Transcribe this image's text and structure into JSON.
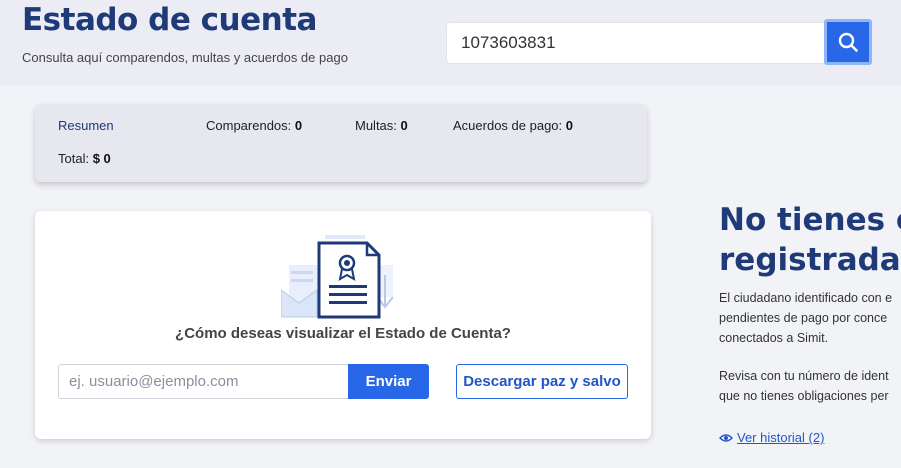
{
  "header": {
    "title": "Estado de cuenta",
    "subtitle": "Consulta aquí comparendos, multas y acuerdos de pago",
    "search_value": "1073603831",
    "search_icon": "search-icon"
  },
  "summary": {
    "resumen_label": "Resumen",
    "comparendos_label": "Comparendos:",
    "comparendos_value": "0",
    "multas_label": "Multas:",
    "multas_value": "0",
    "acuerdos_label": "Acuerdos de pago:",
    "acuerdos_value": "0",
    "total_label": "Total:",
    "total_value": "$ 0"
  },
  "main": {
    "illustration_icon": "document-certificate-icon",
    "question": "¿Cómo deseas visualizar el Estado de Cuenta?",
    "email_placeholder": "ej. usuario@ejemplo.com",
    "send_label": "Enviar",
    "download_label": "Descargar paz y salvo"
  },
  "right": {
    "heading_line1": "No tienes co",
    "heading_line2": "registradas e",
    "para1_lines": [
      "El ciudadano identificado con e",
      "pendientes de pago por conce",
      "conectados a Simit."
    ],
    "para2_lines": [
      "Revisa con tu número de ident",
      "que no tienes obligaciones per"
    ],
    "history_label": "Ver historial (2)",
    "history_icon": "eye-icon"
  },
  "colors": {
    "brand_dark": "#1f3a78",
    "accent": "#2767e8"
  }
}
